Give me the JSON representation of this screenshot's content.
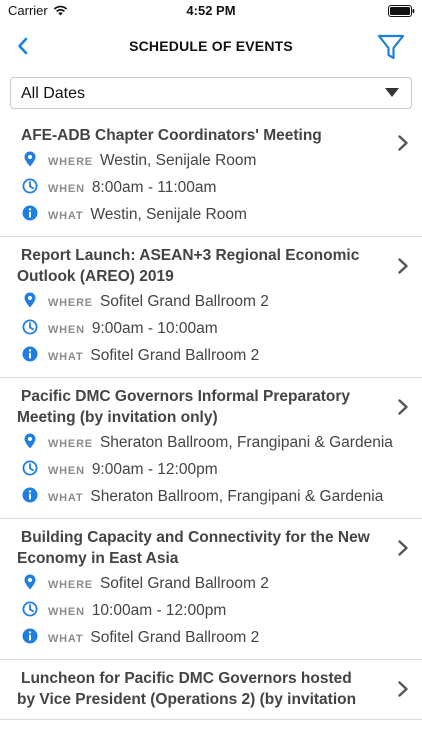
{
  "status_bar": {
    "carrier": "Carrier",
    "time": "4:52 PM"
  },
  "nav": {
    "title": "SCHEDULE OF EVENTS"
  },
  "filter": {
    "selected": "All Dates"
  },
  "labels": {
    "where": "WHERE",
    "when": "WHEN",
    "what": "WHAT"
  },
  "colors": {
    "accent": "#1f7fe0",
    "title_text": "#444444",
    "key_text": "#8b8b8b"
  },
  "events": [
    {
      "title": "AFE-ADB Chapter Coordinators' Meeting",
      "where": "Westin, Senijale Room",
      "when": "8:00am - 11:00am",
      "what": "Westin, Senijale Room"
    },
    {
      "title": "Report Launch: ASEAN+3 Regional Economic Outlook (AREO) 2019",
      "where": "Sofitel Grand Ballroom 2",
      "when": "9:00am - 10:00am",
      "what": "Sofitel Grand Ballroom 2"
    },
    {
      "title": "Pacific DMC Governors Informal Preparatory Meeting (by invitation only)",
      "where": "Sheraton Ballroom, Frangipani & Gardenia",
      "when": "9:00am - 12:00pm",
      "what": "Sheraton Ballroom, Frangipani & Gardenia"
    },
    {
      "title": "Building Capacity and Connectivity for the New Economy in East Asia",
      "where": "Sofitel Grand Ballroom 2",
      "when": "10:00am - 12:00pm",
      "what": "Sofitel Grand Ballroom 2"
    },
    {
      "title": "Luncheon for Pacific DMC Governors hosted by Vice President (Operations 2) (by invitation"
    }
  ]
}
